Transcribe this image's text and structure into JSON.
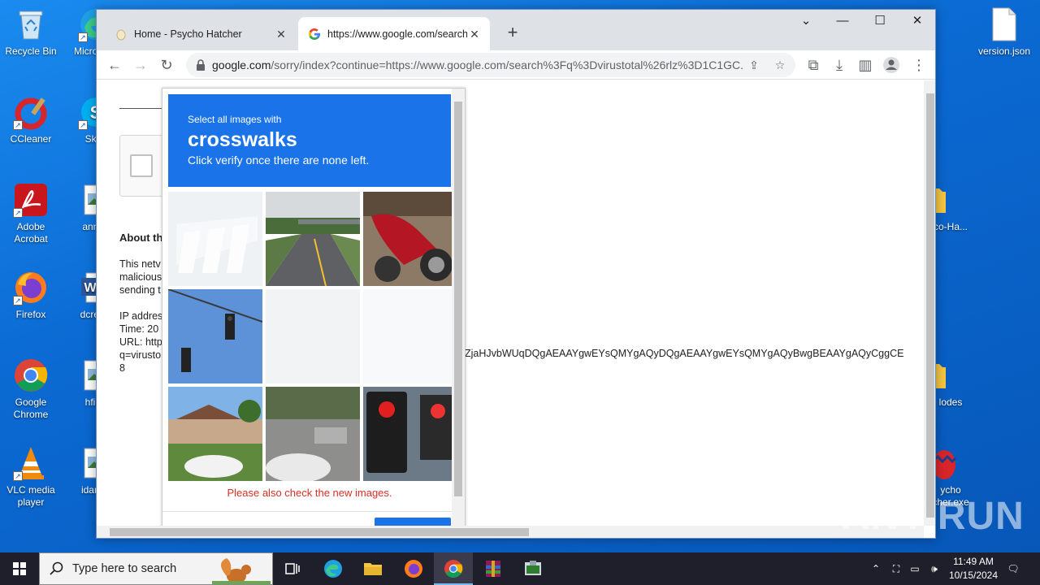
{
  "desktop": {
    "icons_left": [
      {
        "label": "Recycle Bin",
        "icon": "recycle-bin-icon"
      },
      {
        "label": "CCleaner",
        "icon": "ccleaner-icon"
      },
      {
        "label": "Adobe Acrobat",
        "icon": "acrobat-icon"
      },
      {
        "label": "Firefox",
        "icon": "firefox-icon"
      },
      {
        "label": "Google Chrome",
        "icon": "chrome-icon"
      },
      {
        "label": "VLC media player",
        "icon": "vlc-icon"
      }
    ],
    "icons_col2": [
      {
        "label": "Micro Edg",
        "icon": "edge-icon"
      },
      {
        "label": "Skyp",
        "icon": "skype-icon"
      },
      {
        "label": "annou",
        "icon": "image-file-icon"
      },
      {
        "label": "dcregis",
        "icon": "word-icon"
      },
      {
        "label": "hfirm",
        "icon": "image-file-icon"
      },
      {
        "label": "idannu",
        "icon": "image-file-icon"
      }
    ],
    "icons_right": [
      {
        "label": "version.json",
        "icon": "file-icon"
      },
      {
        "label": "co-Ha...",
        "icon": "folder-icon"
      },
      {
        "label": "lodes",
        "icon": "folder-icon"
      },
      {
        "label": "ycho cher.exe",
        "icon": "egg-app-icon"
      }
    ],
    "watermark": "ANY RUN"
  },
  "browser": {
    "tabs": [
      {
        "title": "Home - Psycho Hatcher",
        "active": false
      },
      {
        "title": "https://www.google.com/search",
        "active": true
      }
    ],
    "url_domain": "google.com",
    "url_rest": "/sorry/index?continue=https://www.google.com/search%3Fq%3Dvirustotal%26rlz%3D1C1GC..."
  },
  "page": {
    "about_heading": "About th",
    "para_lines": [
      "This netv",
      "malicious",
      "sending t"
    ],
    "info_lines": [
      "IP addres",
      "Time: 20",
      "URL: http",
      "q=virusto",
      "8"
    ],
    "long_token": "ZjaHJvbWUqDQgAEAAYgwEYsQMYgAQyDQgAEAAYgwEYsQMYgAQyBwgBEAAYgAQyCggCE"
  },
  "captcha": {
    "line1": "Select all images with",
    "target": "crosswalks",
    "line3": "Click verify once there are none left.",
    "error": "Please also check the new images.",
    "tiles": [
      "faded-crosswalk",
      "road-bridge",
      "red-motorcycle",
      "traffic-lights-sky",
      "blank-fading",
      "blank-fading",
      "house-cars",
      "street-car",
      "traffic-signal-red"
    ]
  },
  "taskbar": {
    "search_placeholder": "Type here to search",
    "time": "11:49 AM",
    "date": "10/15/2024"
  }
}
